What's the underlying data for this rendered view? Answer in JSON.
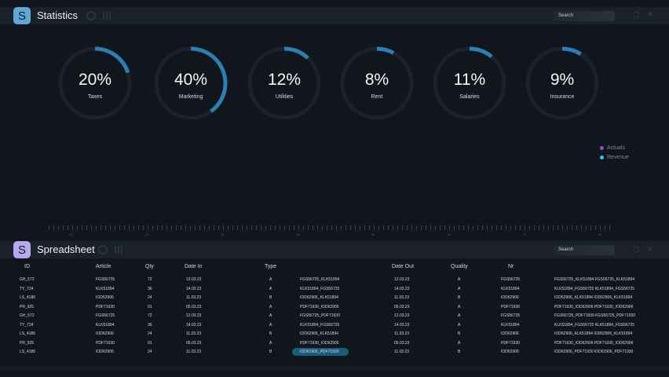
{
  "statistics": {
    "icon_letter": "S",
    "title": "Statistics",
    "search_label": "Search",
    "accent_color": "#2b7fb3",
    "gauges": [
      {
        "value": "20%",
        "label": "Taxes",
        "fraction": 0.2
      },
      {
        "value": "40%",
        "label": "Marketing",
        "fraction": 0.4
      },
      {
        "value": "12%",
        "label": "Utilities",
        "fraction": 0.12
      },
      {
        "value": "8%",
        "label": "Rent",
        "fraction": 0.08
      },
      {
        "value": "11%",
        "label": "Salaries",
        "fraction": 0.11
      },
      {
        "value": "9%",
        "label": "Insurance",
        "fraction": 0.09
      }
    ],
    "legend": [
      {
        "label": "Actuals",
        "color": "#8a4fd6"
      },
      {
        "label": "Revenue",
        "color": "#2fc4ee"
      }
    ],
    "ruler_labels": [
      "10",
      "20",
      "30",
      "40",
      "50",
      "60",
      "70",
      "80"
    ]
  },
  "spreadsheet": {
    "icon_letter": "S",
    "title": "Spreadsheet",
    "search_label": "Search",
    "headers": [
      "ID",
      "Article",
      "Qty",
      "Date In",
      "Type",
      "Date Out",
      "Quality",
      "Nr"
    ],
    "rows": [
      [
        "GH_572",
        "FGS56725",
        "72",
        "12.03.23",
        "A",
        "FGS56725_KLK51894",
        "12.03.23",
        "A",
        "FGS56725",
        "FGS56725_KLK51894 FGS56725_KLK51894"
      ],
      [
        "TY_724",
        "KLK51894",
        "36",
        "14.03.23",
        "A",
        "KLK51894_FGS56725",
        "14.03.23",
        "A",
        "KLK51894",
        "KLK51894_FGS56725 KLK51894_FGS56725"
      ],
      [
        "LS_4186",
        "IOD62906",
        "24",
        "11.03.23",
        "B",
        "IOD62906_KLK51894",
        "11.03.23",
        "B",
        "IOD62906",
        "IOD62906_KLK51894 IOD62906_KLK51894"
      ],
      [
        "PR_925",
        "PDF71930",
        "91",
        "05.03.23",
        "A",
        "PDF71930_IOD62906",
        "05.03.23",
        "A",
        "PDF71930",
        "PDF71930_IOD62906 PDF71930_IOD62906"
      ],
      [
        "GH_572",
        "FGS56725",
        "72",
        "12.03.23",
        "A",
        "FGS56725_PDF71930",
        "12.03.23",
        "A",
        "FGS56725",
        "FGS56725_PDF71930 FGS56725_PDF71930"
      ],
      [
        "TY_724",
        "KLK51894",
        "36",
        "14.03.23",
        "A",
        "KLK51894_FGS56725",
        "14.03.23",
        "A",
        "KLK51894",
        "KLK51894_FGS56725 KLK51894_FGS56725"
      ],
      [
        "LS_4186",
        "IOD62906",
        "24",
        "11.03.23",
        "B",
        "IOD62906_KLK51894",
        "11.03.23",
        "B",
        "IOD62906",
        "IOD62906_KLK51894 IOD62906_KLK51894"
      ],
      [
        "PR_925",
        "PDF71930",
        "91",
        "05.03.23",
        "A",
        "PDF71930_IOD62906",
        "05.03.23",
        "A",
        "PDF71930",
        "PDF71930_IOD62906 PDF71930_IOD62906"
      ],
      [
        "LS_4186",
        "IOD62906",
        "24",
        "11.03.23",
        "B",
        "IOD62906_PDF71930",
        "11.03.23",
        "B",
        "IOD62906",
        "IOD62906_PDF71930 IOD62906_PDF71930"
      ]
    ],
    "selected_row": 8,
    "selected_color": "#1b5a7d"
  }
}
